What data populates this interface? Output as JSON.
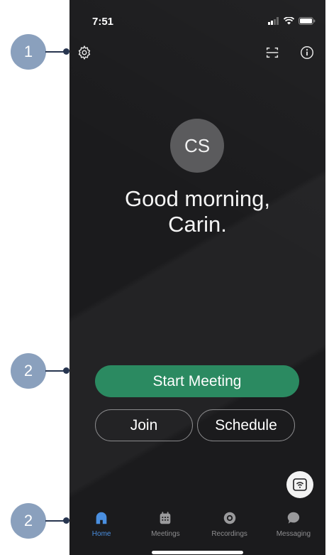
{
  "status_bar": {
    "time": "7:51"
  },
  "greeting": {
    "line1": "Good morning,",
    "line2": "Carin."
  },
  "avatar": {
    "initials": "CS"
  },
  "actions": {
    "start_meeting": "Start Meeting",
    "join": "Join",
    "schedule": "Schedule"
  },
  "tabs": [
    {
      "label": "Home",
      "icon": "home-icon",
      "active": true
    },
    {
      "label": "Meetings",
      "icon": "calendar-icon",
      "active": false
    },
    {
      "label": "Recordings",
      "icon": "recordings-icon",
      "active": false
    },
    {
      "label": "Messaging",
      "icon": "chat-bubble-icon",
      "active": false
    }
  ],
  "annotations": [
    {
      "number": "1",
      "target": "settings"
    },
    {
      "number": "2",
      "target": "action buttons"
    },
    {
      "number": "2",
      "target": "tab bar"
    }
  ],
  "colors": {
    "background": "#1b1b1d",
    "accent_green": "#2b8a61",
    "active_tab": "#4a8fe0",
    "callout": "#8aa0bd"
  }
}
